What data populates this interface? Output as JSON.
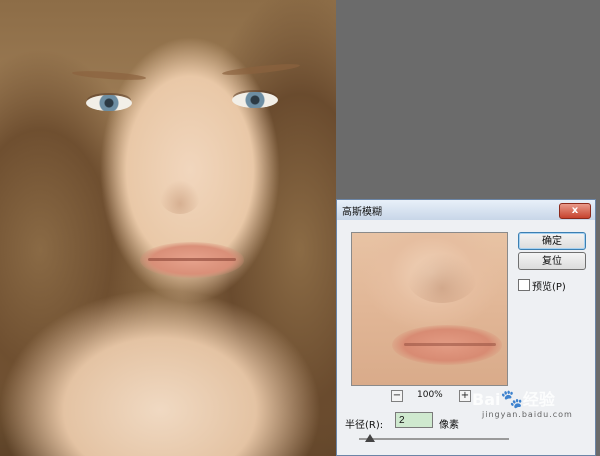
{
  "dialog": {
    "title": "高斯模糊",
    "close_label": "x",
    "buttons": {
      "ok_label": "确定",
      "reset_label": "复位"
    },
    "preview_checkbox": {
      "label": "预览(P)",
      "checked": false
    },
    "zoom": {
      "minus": "−",
      "value": "100%",
      "plus": "+"
    },
    "radius": {
      "label": "半径(R):",
      "value": "2",
      "unit": "像素"
    },
    "slider_level_fraction": 0.07
  },
  "watermark": {
    "brand": "Bai",
    "brand_suffix": "经验",
    "site": "jingyan.baidu.com"
  },
  "icons": [
    "close-icon",
    "zoom-out-icon",
    "zoom-in-icon",
    "slider-thumb-icon",
    "baidu-paw-icon"
  ],
  "colors": {
    "workspace_bg": "#6b6b6b",
    "dialog_bg": "#eef0f3",
    "close_button": "#c6432f",
    "radius_input_bg": "#cfe9cf"
  }
}
